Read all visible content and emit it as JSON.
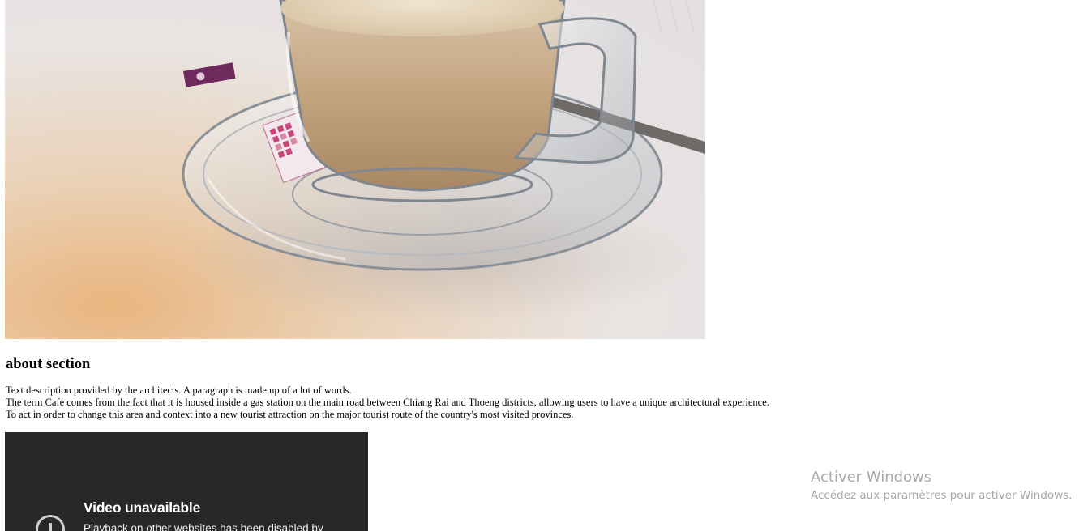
{
  "about": {
    "heading": "about section",
    "lines": [
      "Text description provided by the architects. A paragraph is made up of a lot of words.",
      "The term Cafe comes from the fact that it is housed inside a gas station on the main road between Chiang Rai and Thoeng districts, allowing users to have a unique architectural experience.",
      "To act in order to change this area and context into a new tourist attraction on the major tourist route of the country's most visited provinces."
    ]
  },
  "video": {
    "title": "Video unavailable",
    "message": "Playback on other websites has been disabled by"
  },
  "watermark": {
    "title": "Activer Windows",
    "subtitle": "Accédez aux paramètres pour activer Windows."
  },
  "colors": {
    "video_background": "#282828",
    "watermark_text": "#787878"
  },
  "icons": {
    "video_error": "alert-circle-icon"
  }
}
